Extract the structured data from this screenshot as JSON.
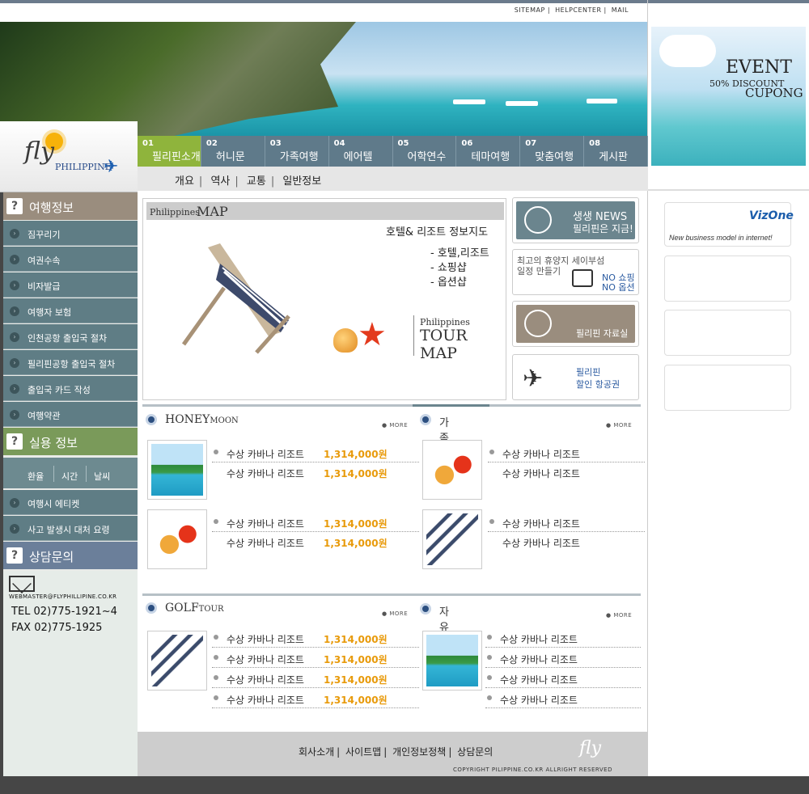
{
  "top_links": [
    "SITEMAP",
    "HELPCENTER",
    "MAIL"
  ],
  "logo": {
    "fly": "fly",
    "philippine": "PHILIPPINE"
  },
  "nav": [
    {
      "num": "01",
      "label": "필리핀소개"
    },
    {
      "num": "02",
      "label": "허니문"
    },
    {
      "num": "03",
      "label": "가족여행"
    },
    {
      "num": "04",
      "label": "에어텔"
    },
    {
      "num": "05",
      "label": "어학연수"
    },
    {
      "num": "06",
      "label": "테마여행"
    },
    {
      "num": "07",
      "label": "맞춤여행"
    },
    {
      "num": "08",
      "label": "게시판"
    }
  ],
  "subnav": [
    "개요",
    "역사",
    "교통",
    "일반정보"
  ],
  "event": {
    "title": "EVENT",
    "discount": "50% DISCOUNT",
    "cupong": "CUPONG"
  },
  "vizone": {
    "brand": "VizOne",
    "tagline": "New business model  in internet!"
  },
  "sidebar": {
    "travel_title": "여행정보",
    "travel_items": [
      "짐꾸리기",
      "여권수속",
      "비자발급",
      "여행자 보험",
      "인천공항 출입국 절차",
      "필리핀공항 출입국 절차",
      "출입국 카드 작성",
      "여행약관"
    ],
    "util_title": "실용 정보",
    "util_tabs": [
      "환율",
      "시간",
      "날씨"
    ],
    "util_items": [
      "여행시 에티켓",
      "사고 발생시 대처 요령"
    ],
    "contact_title": "상담문의",
    "email": "WEBMASTER@FLYPHILLIPINE.CO.KR",
    "tel": "TEL 02)775-1921~4",
    "fax": "FAX 02)775-1925"
  },
  "map": {
    "head_small": "Philippines",
    "head_big": "MAP",
    "title": "호텔& 리조트 정보지도",
    "items": [
      "- 호텔,리조트",
      "- 쇼핑샵",
      "- 옵션샵"
    ],
    "tour_a": "Philippines",
    "tour_b": "TOUR MAP"
  },
  "side_buttons": {
    "news_1": "생생 NEWS",
    "news_2": "필리핀은 지금!",
    "shop_1": "최고의 휴양지 세이부섬",
    "shop_2": "일정 만들기",
    "shop_3": "NO 쇼핑",
    "shop_4": "NO 옵션",
    "data_1": "필리핀 자료실",
    "air_1": "필리핀",
    "air_2": "할인 항공권"
  },
  "sections": {
    "honeymoon": {
      "big": "HONEY",
      "small": "MOON"
    },
    "family": "가족여행",
    "golf": {
      "big": "GOLF",
      "small": "TOUR"
    },
    "free": "자유여행",
    "more": "MORE"
  },
  "item_name": "수상 카바나 리조트",
  "item_price": "1,314,000원",
  "footer": {
    "links": [
      "회사소개",
      "사이트맵",
      "개인정보정책",
      "상담문의"
    ],
    "copyright": "COPYRIGHT PILIPPINE.CO.KR ALLRIGHT RESERVED",
    "fly": "fly"
  },
  "colors": {
    "nav": "#5f7a8a",
    "nav_active": "#8fb43c",
    "price": "#e89a0a",
    "side_travel": "#9a8d7e",
    "side_util": "#7a9a5a",
    "side_contact": "#6b7f9a"
  }
}
